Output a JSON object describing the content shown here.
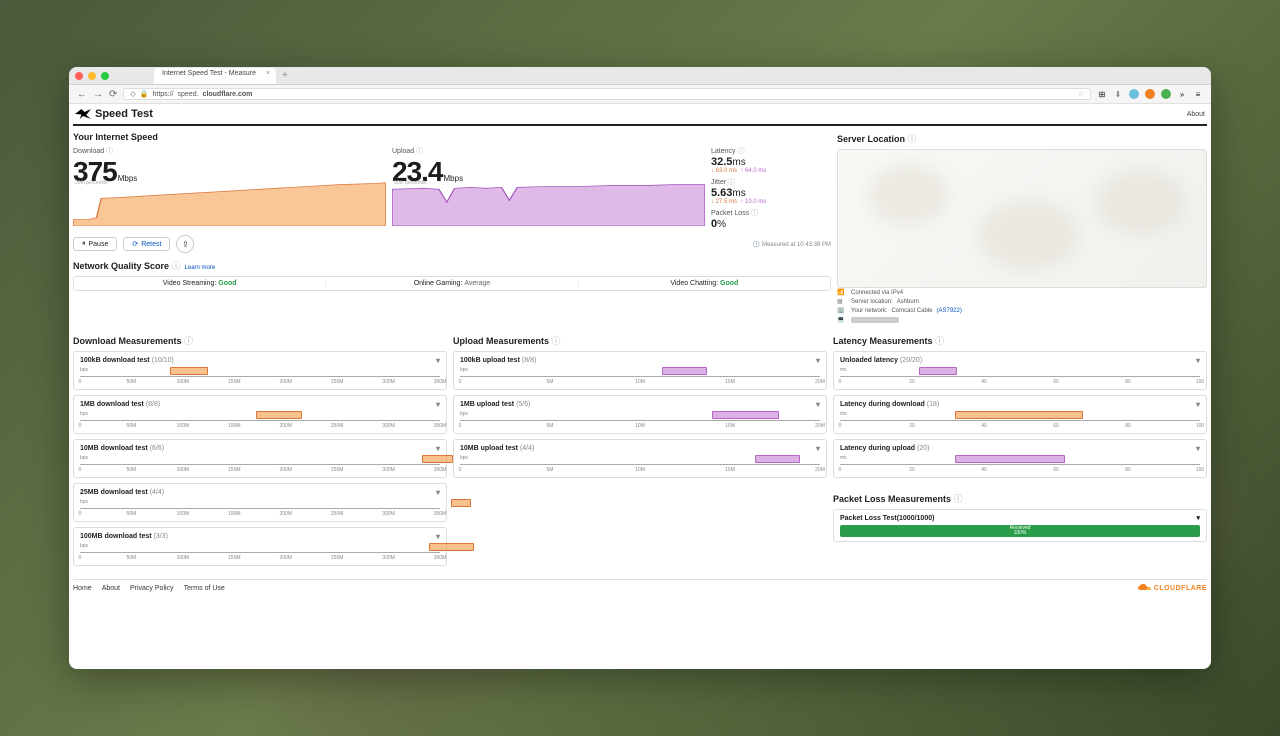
{
  "browser": {
    "tab_title": "Internet Speed Test - Measure",
    "url_scheme": "https://",
    "url_host": "speed.",
    "url_domain": "cloudflare.com",
    "about": "About"
  },
  "header": {
    "title": "Speed Test"
  },
  "summary": {
    "section": "Your Internet Speed",
    "download_label": "Download",
    "download_value": "375",
    "download_unit": "Mbps",
    "download_note": "90th percentile",
    "upload_label": "Upload",
    "upload_value": "23.4",
    "upload_unit": "Mbps",
    "upload_note": "90th percentile",
    "latency_label": "Latency",
    "latency_value": "32.5",
    "latency_unit": "ms",
    "latency_down": "↓ 63.0 ms",
    "latency_up": "↑ 64.0 ms",
    "jitter_label": "Jitter",
    "jitter_value": "5.63",
    "jitter_unit": "ms",
    "jitter_down": "↓ 27.5 ms",
    "jitter_up": "↑ 10.0 ms",
    "pl_label": "Packet Loss",
    "pl_value": "0",
    "pl_unit": "%",
    "pause": "Pause",
    "retest": "Retest",
    "measured": "Measured at 10:43:38 PM"
  },
  "nqs": {
    "title": "Network Quality Score",
    "learn": "Learn more",
    "vs_label": "Video Streaming:",
    "vs_val": "Good",
    "og_label": "Online Gaming:",
    "og_val": "Average",
    "vc_label": "Video Chatting:",
    "vc_val": "Good"
  },
  "server": {
    "section": "Server Location",
    "conn": "Connected via IPv4",
    "loc_label": "Server location:",
    "loc_val": "Ashburn",
    "net_label": "Your network:",
    "net_val": "Comcast Cable",
    "asn": "(AS7922)",
    "ip_hidden": "■■■■■■■■■■■"
  },
  "dlm": {
    "section": "Download Measurements",
    "axis_unit": "bps",
    "ticks": [
      "0",
      "50M",
      "100M",
      "150M",
      "200M",
      "250M",
      "300M",
      "350M"
    ],
    "tests": [
      {
        "name": "100kB download test",
        "count": "(10/10)"
      },
      {
        "name": "1MB download test",
        "count": "(8/8)"
      },
      {
        "name": "10MB download test",
        "count": "(6/6)"
      },
      {
        "name": "25MB download test",
        "count": "(4/4)"
      },
      {
        "name": "100MB download test",
        "count": "(3/3)"
      }
    ]
  },
  "ulm": {
    "section": "Upload Measurements",
    "axis_unit": "bps",
    "ticks": [
      "0",
      "5M",
      "10M",
      "15M",
      "20M"
    ],
    "tests": [
      {
        "name": "100kB upload test",
        "count": "(8/8)"
      },
      {
        "name": "1MB upload test",
        "count": "(5/6)"
      },
      {
        "name": "10MB upload test",
        "count": "(4/4)"
      }
    ]
  },
  "lat": {
    "section": "Latency Measurements",
    "axis_unit": "ms",
    "ticks": [
      "0",
      "20",
      "40",
      "60",
      "80",
      "100"
    ],
    "tests": [
      {
        "name": "Unloaded latency",
        "count": "(20/20)"
      },
      {
        "name": "Latency during download",
        "count": "(18)"
      },
      {
        "name": "Latency during upload",
        "count": "(20)"
      }
    ]
  },
  "pl": {
    "section": "Packet Loss Measurements",
    "test_name": "Packet Loss Test",
    "test_count": "(1000/1000)",
    "bar_label": "Received",
    "bar_val": "100%"
  },
  "footer": {
    "home": "Home",
    "about": "About",
    "privacy": "Privacy Policy",
    "terms": "Terms of Use",
    "brand": "CLOUDFLARE"
  },
  "chart_data": [
    {
      "type": "area",
      "name": "download-spark",
      "ylabel": "Mbps",
      "ylim": [
        0,
        420
      ],
      "x": [
        0,
        1,
        2,
        3,
        4,
        5,
        6,
        7,
        8,
        9,
        10,
        11,
        12,
        13,
        14,
        15
      ],
      "values": [
        60,
        60,
        75,
        250,
        255,
        270,
        280,
        295,
        310,
        330,
        350,
        365,
        380,
        390,
        398,
        402
      ]
    },
    {
      "type": "area",
      "name": "upload-spark",
      "ylabel": "Mbps",
      "ylim": [
        0,
        27
      ],
      "x": [
        0,
        1,
        2,
        3,
        4,
        5,
        6,
        7,
        8,
        9,
        10,
        11,
        12,
        13,
        14,
        15
      ],
      "values": [
        22,
        23,
        22.5,
        16,
        23,
        23.5,
        23,
        17,
        23.5,
        24,
        24,
        24,
        24.2,
        24.5,
        24.3,
        24.5
      ]
    },
    {
      "type": "boxplot",
      "name": "dl-100kB",
      "x": "bps",
      "range": [
        0,
        380000000
      ],
      "q1": 95000000,
      "median": 110000000,
      "q3": 125000000
    },
    {
      "type": "boxplot",
      "name": "dl-1MB",
      "x": "bps",
      "range": [
        0,
        380000000
      ],
      "q1": 185000000,
      "median": 210000000,
      "q3": 230000000
    },
    {
      "type": "boxplot",
      "name": "dl-10MB",
      "x": "bps",
      "range": [
        0,
        380000000
      ],
      "q1": 365000000,
      "median": 380000000,
      "q3": 395000000
    },
    {
      "type": "boxplot",
      "name": "dl-25MB",
      "x": "bps",
      "range": [
        0,
        380000000
      ],
      "q1": 400000000,
      "median": 410000000,
      "q3": 420000000
    },
    {
      "type": "boxplot",
      "name": "dl-100MB",
      "x": "bps",
      "range": [
        0,
        380000000
      ],
      "q1": 375000000,
      "median": 400000000,
      "q3": 425000000
    },
    {
      "type": "boxplot",
      "name": "ul-100kB",
      "x": "bps",
      "range": [
        0,
        22000000
      ],
      "q1": 12500000,
      "median": 13500000,
      "q3": 14500000
    },
    {
      "type": "boxplot",
      "name": "ul-1MB",
      "x": "bps",
      "range": [
        0,
        22000000
      ],
      "q1": 15500000,
      "median": 17000000,
      "q3": 18500000
    },
    {
      "type": "boxplot",
      "name": "ul-10MB",
      "x": "bps",
      "range": [
        0,
        22000000
      ],
      "q1": 18000000,
      "median": 19000000,
      "q3": 20000000
    },
    {
      "type": "boxplot",
      "name": "lat-unloaded",
      "x": "ms",
      "range": [
        0,
        110
      ],
      "q1": 24,
      "median": 27,
      "q3": 31
    },
    {
      "type": "boxplot",
      "name": "lat-download",
      "x": "ms",
      "range": [
        0,
        110
      ],
      "q1": 35,
      "median": 55,
      "q3": 70
    },
    {
      "type": "boxplot",
      "name": "lat-upload",
      "x": "ms",
      "range": [
        0,
        110
      ],
      "q1": 35,
      "median": 50,
      "q3": 65
    }
  ]
}
